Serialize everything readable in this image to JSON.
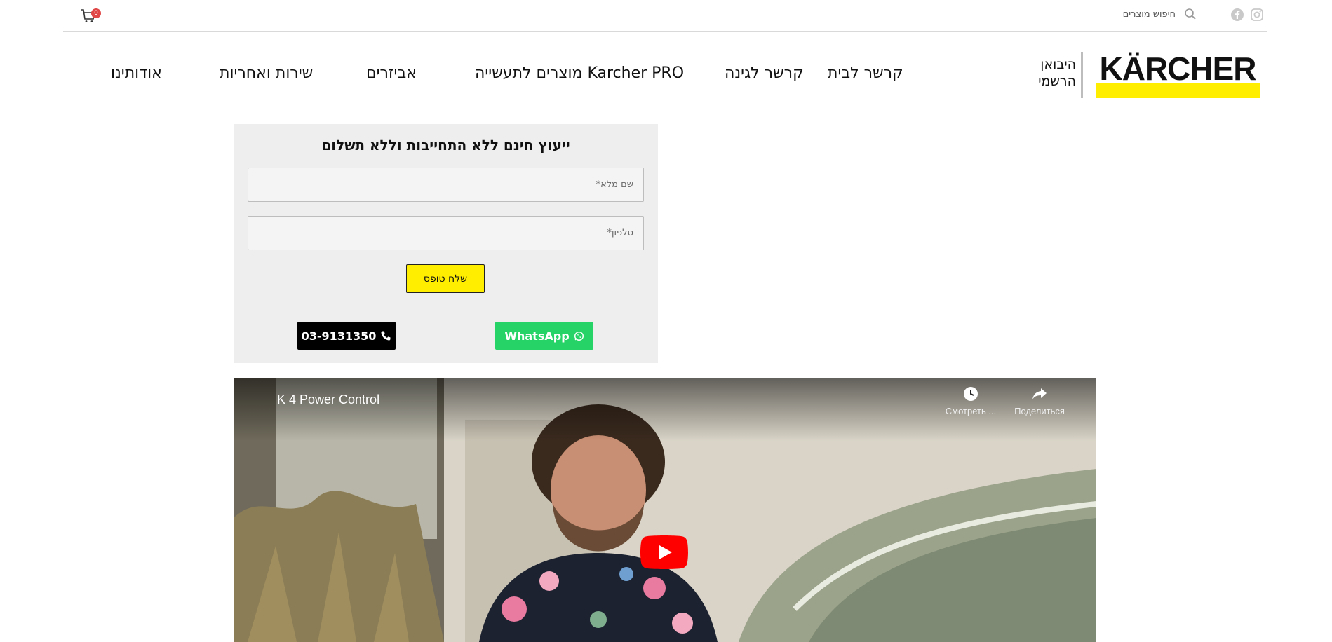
{
  "topbar": {
    "cart_count": "0",
    "search_label": "חיפוש מוצרים"
  },
  "header": {
    "logo_text": "KÄRCHER",
    "importer_line1": "היבואן",
    "importer_line2": "הרשמי",
    "nav": [
      {
        "label": "קרשר לבית"
      },
      {
        "label": "קרשר לגינה"
      },
      {
        "label": "מוצרים לתעשייה Karcher PRO"
      },
      {
        "label": "אביזרים"
      },
      {
        "label": "שירות ואחריות"
      },
      {
        "label": "אודותינו"
      }
    ]
  },
  "form": {
    "title": "ייעוץ חינם ללא התחייבות וללא תשלום",
    "name_placeholder": "שם מלא*",
    "phone_placeholder": "טלפון*",
    "submit_label": "שלח טופס",
    "whatsapp_label": "WhatsApp",
    "phone_label": "03-9131350"
  },
  "video": {
    "title": "K 4 Power Control",
    "watch_later": "Смотреть ...",
    "share": "Поделиться"
  },
  "colors": {
    "brand_yellow": "#ffee00",
    "whatsapp_green": "#25d366",
    "form_bg": "#eeeeee",
    "youtube_red": "#ff0000"
  }
}
